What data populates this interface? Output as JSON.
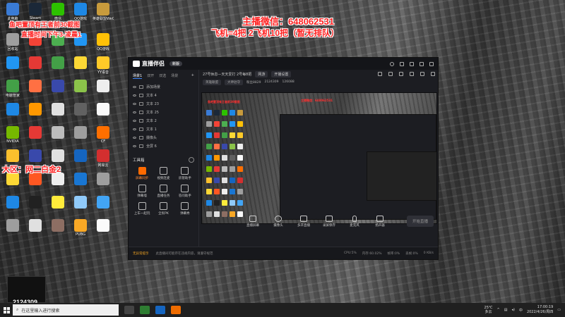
{
  "overlay": {
    "streamer_wechat": "主播微信：648062531",
    "plane_info": "飞机=4把 2飞机10把（暂无排队）",
    "screenshot_note": "鱼吧置顶有王者前30截图",
    "stream_time": "直播时间下午3-凌晨1",
    "region": "大区：网二白金2",
    "room_id": "2124309"
  },
  "desktop": {
    "icons": [
      {
        "label": "此电脑",
        "color": "#3a7bd5"
      },
      {
        "label": "Steam",
        "color": "#1b2838"
      },
      {
        "label": "微信",
        "color": "#2dc100"
      },
      {
        "label": "QQ游戏",
        "color": "#1e88e5"
      },
      {
        "label": "英雄联盟WeGame",
        "color": "#c89b3c"
      },
      {
        "label": "回收站",
        "color": "#9e9e9e"
      },
      {
        "label": "",
        "color": "#f44336"
      },
      {
        "label": "",
        "color": "#4caf50"
      },
      {
        "label": "",
        "color": "#2196f3"
      },
      {
        "label": "QQ游戏",
        "color": "#ffc107"
      },
      {
        "label": "",
        "color": "#2196f3"
      },
      {
        "label": "",
        "color": "#e53935"
      },
      {
        "label": "",
        "color": "#43a047"
      },
      {
        "label": "",
        "color": "#fdd835"
      },
      {
        "label": "YY语音",
        "color": "#ffca28"
      },
      {
        "label": "电脑管家",
        "color": "#43a047"
      },
      {
        "label": "",
        "color": "#ff7043"
      },
      {
        "label": "",
        "color": "#3949ab"
      },
      {
        "label": "",
        "color": "#8bc34a"
      },
      {
        "label": "",
        "color": "#eeeeee"
      },
      {
        "label": "",
        "color": "#1e88e5"
      },
      {
        "label": "",
        "color": "#ff9800"
      },
      {
        "label": "",
        "color": "#e0e0e0"
      },
      {
        "label": "",
        "color": "#616161"
      },
      {
        "label": "",
        "color": "#fafafa"
      },
      {
        "label": "NVIDIA",
        "color": "#76b900"
      },
      {
        "label": "",
        "color": "#e53935"
      },
      {
        "label": "",
        "color": "#bdbdbd"
      },
      {
        "label": "",
        "color": "#9e9e9e"
      },
      {
        "label": "CF",
        "color": "#ff6f00"
      },
      {
        "label": "",
        "color": "#fbc02d"
      },
      {
        "label": "",
        "color": "#3949ab"
      },
      {
        "label": "",
        "color": "#e0e0e0"
      },
      {
        "label": "",
        "color": "#1565c0"
      },
      {
        "label": "网易云",
        "color": "#d32f2f"
      },
      {
        "label": "",
        "color": "#fdd835"
      },
      {
        "label": "",
        "color": "#ff5722"
      },
      {
        "label": "",
        "color": "#eeeeee"
      },
      {
        "label": "",
        "color": "#1976d2"
      },
      {
        "label": "",
        "color": "#9e9e9e"
      },
      {
        "label": "",
        "color": "#1e88e5"
      },
      {
        "label": "",
        "color": "#212121"
      },
      {
        "label": "",
        "color": "#ffeb3b"
      },
      {
        "label": "",
        "color": "#90caf9"
      },
      {
        "label": "",
        "color": "#42a5f5"
      },
      {
        "label": "",
        "color": "#9e9e9e"
      },
      {
        "label": "",
        "color": "#e0e0e0"
      },
      {
        "label": "",
        "color": "#8d6e63"
      },
      {
        "label": "PUBG",
        "color": "#f9a825"
      },
      {
        "label": "",
        "color": "#fafafa"
      }
    ]
  },
  "app": {
    "name": "直播伴侣",
    "version": "新版",
    "left_tabs": [
      "场景1",
      "双开",
      "双选",
      "场景"
    ],
    "scenes": [
      {
        "label": "添加场景"
      },
      {
        "label": "文本 4"
      },
      {
        "label": "文本 23"
      },
      {
        "label": "文本 25"
      },
      {
        "label": "文本 2"
      },
      {
        "label": "文本 1"
      },
      {
        "label": "摄像头"
      },
      {
        "label": "全屏 6"
      }
    ],
    "tools_title": "工具箱",
    "tools": [
      {
        "label": "屏幕同步",
        "hot": true
      },
      {
        "label": "视频连麦",
        "hot": false
      },
      {
        "label": "房管助手",
        "hot": false
      },
      {
        "label": "弹幕墙",
        "hot": false
      },
      {
        "label": "直播任务",
        "hot": false
      },
      {
        "label": "答问助手",
        "hot": false
      },
      {
        "label": "上车一起玩",
        "hot": false
      },
      {
        "label": "全民PK",
        "hot": false
      },
      {
        "label": "弹幕秀",
        "hot": false
      }
    ],
    "info": {
      "room_title": "27号休息—天天爱打 2号每8把",
      "category": "网游",
      "edit": "开播设置",
      "sub1": "英雄联盟",
      "sub2": "大神驻守",
      "fans": "粉丝8829",
      "room": "2124309",
      "heat": "126088"
    },
    "controls": [
      "直播屏幕",
      "摄像头",
      "多开直播",
      "录屏保存",
      "麦克风",
      "扬声器"
    ],
    "golive": "开始直播",
    "status": {
      "warn": "无异常提示",
      "msg": "此直播间可能存在违规内容，请遵守规范",
      "cpu": "CPU:5%",
      "mem": "内存:60.02%",
      "fps": "帧率:0%",
      "drop": "丢帧:0%",
      "bitrate": "0 KB/s"
    }
  },
  "taskbar": {
    "search_placeholder": "在这里输入进行搜索",
    "weather_temp": "25℃",
    "weather_desc": "多云",
    "time": "17:00:19",
    "date": "2022/4/26/周四"
  },
  "colors": {
    "overlay_red": "#ff2020",
    "accent_orange": "#ff6a00"
  }
}
